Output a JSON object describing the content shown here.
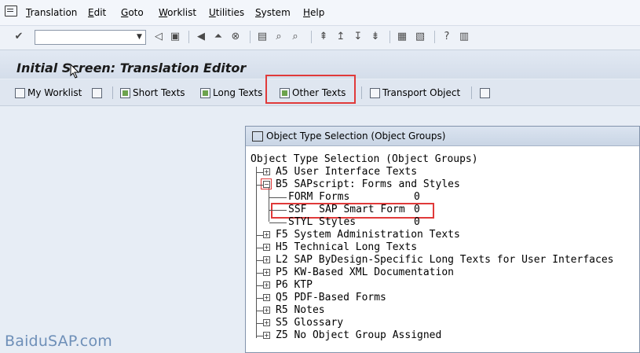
{
  "menu": {
    "items": [
      "Translation",
      "Edit",
      "Goto",
      "Worklist",
      "Utilities",
      "System",
      "Help"
    ]
  },
  "toolbar": {
    "command_field_value": "",
    "icons": [
      "enter-icon",
      "back-icon",
      "save-icon",
      "back-nav-icon",
      "exit-icon",
      "cancel-icon",
      "print-icon",
      "find-icon",
      "find-next-icon",
      "first-page-icon",
      "prev-page-icon",
      "next-page-icon",
      "last-page-icon",
      "new-session-icon",
      "shortcut-icon",
      "help-icon",
      "layout-icon"
    ]
  },
  "title": {
    "text": "Initial Screen: Translation Editor"
  },
  "app_toolbar": {
    "my_worklist": "My Worklist",
    "short_texts": "Short Texts",
    "long_texts": "Long Texts",
    "other_texts": "Other Texts",
    "transport_object": "Transport Object"
  },
  "popup": {
    "title": "Object Type Selection (Object Groups)",
    "root": "Object Type Selection (Object Groups)",
    "items": [
      {
        "code": "A5",
        "text": "User Interface Texts",
        "expanded": false
      },
      {
        "code": "B5",
        "text": "SAPscript: Forms and Styles",
        "expanded": true,
        "children": [
          {
            "text": "FORM Forms",
            "count": "0"
          },
          {
            "text": "SSF  SAP Smart Form",
            "count": "0"
          },
          {
            "text": "STYL Styles",
            "count": "0"
          }
        ]
      },
      {
        "code": "F5",
        "text": "System Administration Texts",
        "expanded": false
      },
      {
        "code": "H5",
        "text": "Technical Long Texts",
        "expanded": false
      },
      {
        "code": "L2",
        "text": "SAP ByDesign-Specific Long Texts for User Interfaces",
        "expanded": false
      },
      {
        "code": "P5",
        "text": "KW-Based XML Documentation",
        "expanded": false
      },
      {
        "code": "P6",
        "text": "KTP",
        "expanded": false
      },
      {
        "code": "Q5",
        "text": "PDF-Based Forms",
        "expanded": false
      },
      {
        "code": "R5",
        "text": "Notes",
        "expanded": false
      },
      {
        "code": "S5",
        "text": "Glossary",
        "expanded": false
      },
      {
        "code": "Z5",
        "text": "No Object Group Assigned",
        "expanded": false
      }
    ]
  },
  "watermark": "BaiduSAP.com",
  "colors": {
    "highlight": "#e03a3a",
    "watermark": "#6e8fb8"
  }
}
